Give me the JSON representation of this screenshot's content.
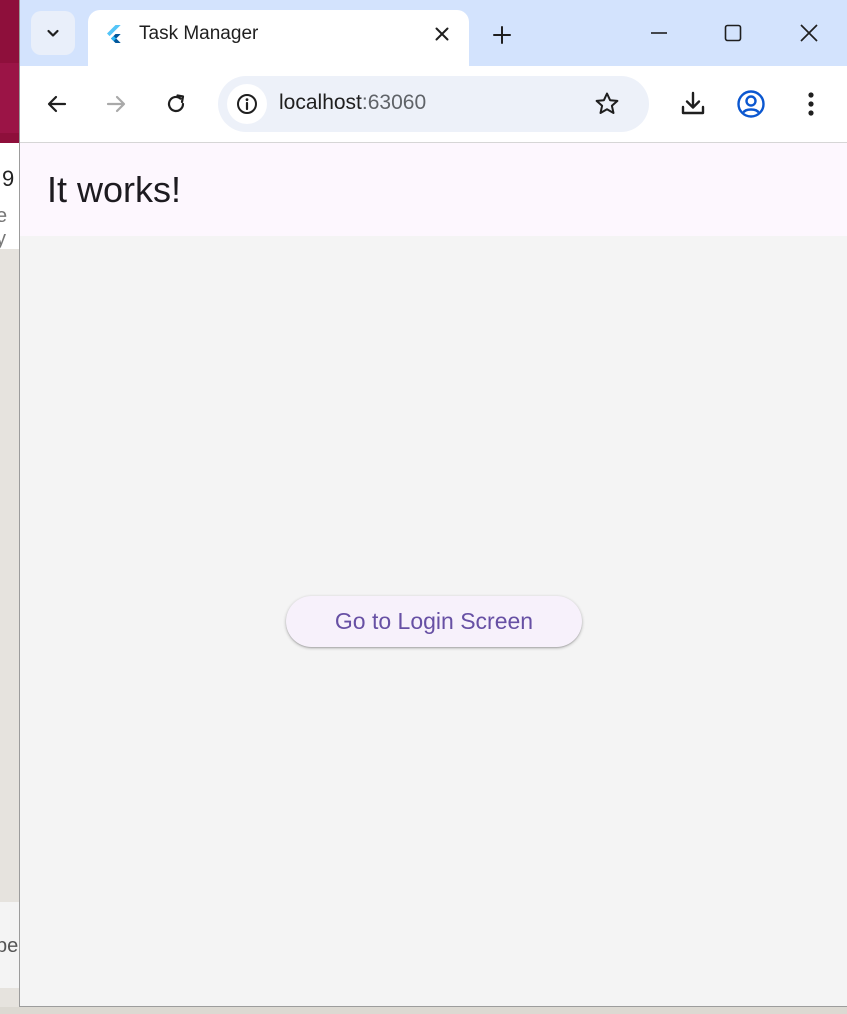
{
  "background_app": {
    "text_1": "9",
    "text_2": "e y",
    "text_3": "pe"
  },
  "browser": {
    "tab": {
      "title": "Task Manager",
      "favicon": "flutter-logo-icon"
    },
    "toolbar": {
      "url_host": "localhost",
      "url_port": ":63060"
    },
    "icons": {
      "tab_search": "chevron-down-icon",
      "close_tab": "close-icon",
      "new_tab": "plus-icon",
      "minimize": "minimize-icon",
      "maximize": "maximize-icon",
      "close_window": "close-icon",
      "back": "arrow-left-icon",
      "forward": "arrow-right-icon",
      "reload": "reload-icon",
      "site_info": "info-icon",
      "bookmark": "star-icon",
      "downloads": "download-icon",
      "profile": "profile-icon",
      "menu": "more-vert-icon"
    }
  },
  "page": {
    "appbar_title": "It works!",
    "login_button_label": "Go to Login Screen"
  },
  "colors": {
    "tabstrip": "#d3e3fd",
    "appbar_bg": "#fdf7fe",
    "button_text": "#6750a4",
    "profile_accent": "#0b57d0"
  }
}
